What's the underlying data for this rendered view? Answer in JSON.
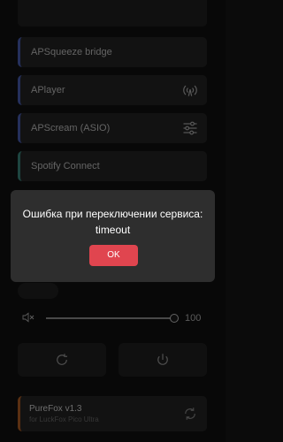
{
  "services": [
    {
      "label": "APSqueeze bridge",
      "icon": "none"
    },
    {
      "label": "APlayer",
      "icon": "broadcast-icon"
    },
    {
      "label": "APScream (ASIO)",
      "icon": "sliders-icon"
    },
    {
      "label": "Spotify Connect",
      "icon": "none"
    }
  ],
  "volume": {
    "value": "100",
    "level": 1.0
  },
  "footer": {
    "title": "PureFox v1.3",
    "subtitle": "for LuckFox Pico Ultra"
  },
  "dialog": {
    "message": "Ошибка при переключении сервиса: timeout",
    "ok_label": "OK"
  },
  "colors": {
    "accent_blue": "#3a4a8c",
    "accent_green": "#2f6b63",
    "accent_orange": "#8a4a1c",
    "ok_button": "#e0454f"
  }
}
